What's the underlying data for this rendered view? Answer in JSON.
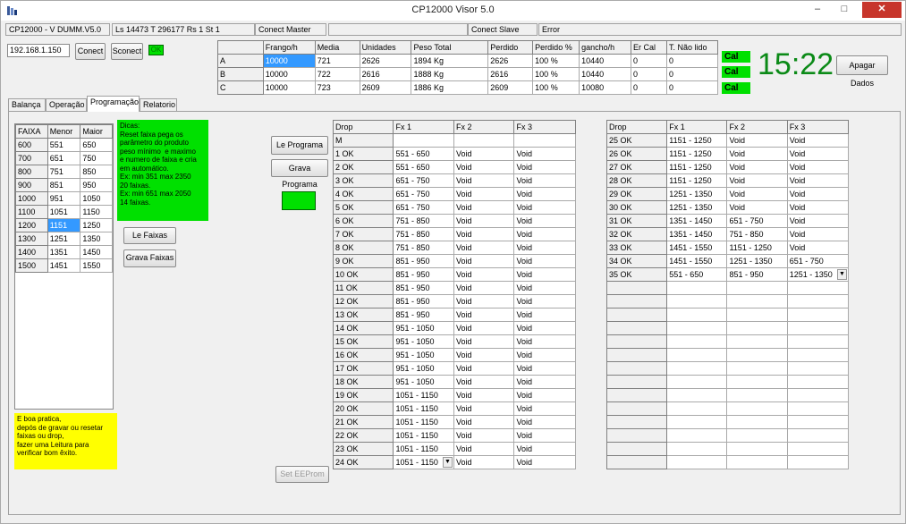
{
  "window": {
    "title": "CP12000 Visor 5.0",
    "minimize": "–",
    "maximize": "□",
    "close": "✕"
  },
  "status": {
    "version": "CP12000 - V DUMM.V5.0",
    "info": "Ls 14473 T 296177 Rs 1 St 1",
    "master": "Conect Master",
    "slave": "Conect Slave",
    "error": "Error"
  },
  "conn": {
    "ip": "192.168.1.150",
    "connect": "Conect",
    "disconnect": "Sconect",
    "ok": "OK"
  },
  "top_table": {
    "headers": [
      "",
      "Frango/h",
      "Media",
      "Unidades",
      "Peso Total",
      "Perdido",
      "Perdido %",
      "gancho/h",
      "Er Cal",
      "T. Não lido"
    ],
    "rows": [
      [
        "A",
        "10000",
        "721",
        "2626",
        "1894 Kg",
        "2626",
        "100 %",
        "10440",
        "0",
        "0"
      ],
      [
        "B",
        "10000",
        "722",
        "2616",
        "1888 Kg",
        "2616",
        "100 %",
        "10440",
        "0",
        "0"
      ],
      [
        "C",
        "10000",
        "723",
        "2609",
        "1886 Kg",
        "2609",
        "100 %",
        "10080",
        "0",
        "0"
      ]
    ]
  },
  "cal": [
    "Cal",
    "Cal",
    "Cal"
  ],
  "clock": "15:22",
  "apagar": "Apagar Dados",
  "tabs": [
    "Balança",
    "Operação",
    "Programação",
    "Relatorio"
  ],
  "faixa": {
    "headers": [
      "FAIXA",
      "Menor",
      "Maior"
    ],
    "rows": [
      [
        "600",
        "551",
        "650"
      ],
      [
        "700",
        "651",
        "750"
      ],
      [
        "800",
        "751",
        "850"
      ],
      [
        "900",
        "851",
        "950"
      ],
      [
        "1000",
        "951",
        "1050"
      ],
      [
        "1100",
        "1051",
        "1150"
      ],
      [
        "1200",
        "1151",
        "1250"
      ],
      [
        "1300",
        "1251",
        "1350"
      ],
      [
        "1400",
        "1351",
        "1450"
      ],
      [
        "1500",
        "1451",
        "1550"
      ]
    ]
  },
  "dicas": "Dicas:\nReset faixa pega os\nparâmetro do produto\npeso mínimo  e maximo\ne numero de faixa e cria\nem automático.\nEx: min 351 max 2350\n20 faixas.\nEx: min 651 max 2050\n14 faixas.",
  "le_faixas": "Le Faixas",
  "grava_faixas": "Grava Faixas",
  "boa_pratica": "E boa pratica,\ndepós de gravar ou resetar\nfaixas ou drop,\nfazer uma Leitura para\nverificar bom êxito.",
  "le_programa": "Le Programa",
  "grava_programa": "Grava Programa",
  "set_eeprom": "Set EEProm",
  "drop1": {
    "headers": [
      "Drop",
      "Fx 1",
      "Fx 2",
      "Fx 3"
    ],
    "rows": [
      [
        "M",
        "",
        "",
        ""
      ],
      [
        "1 OK",
        "551 - 650",
        "Void",
        "Void"
      ],
      [
        "2 OK",
        "551 - 650",
        "Void",
        "Void"
      ],
      [
        "3 OK",
        "651 - 750",
        "Void",
        "Void"
      ],
      [
        "4 OK",
        "651 - 750",
        "Void",
        "Void"
      ],
      [
        "5 OK",
        "651 - 750",
        "Void",
        "Void"
      ],
      [
        "6 OK",
        "751 - 850",
        "Void",
        "Void"
      ],
      [
        "7 OK",
        "751 - 850",
        "Void",
        "Void"
      ],
      [
        "8 OK",
        "751 - 850",
        "Void",
        "Void"
      ],
      [
        "9 OK",
        "851 - 950",
        "Void",
        "Void"
      ],
      [
        "10 OK",
        "851 - 950",
        "Void",
        "Void"
      ],
      [
        "11 OK",
        "851 - 950",
        "Void",
        "Void"
      ],
      [
        "12 OK",
        "851 - 950",
        "Void",
        "Void"
      ],
      [
        "13 OK",
        "851 - 950",
        "Void",
        "Void"
      ],
      [
        "14 OK",
        "951 - 1050",
        "Void",
        "Void"
      ],
      [
        "15 OK",
        "951 - 1050",
        "Void",
        "Void"
      ],
      [
        "16 OK",
        "951 - 1050",
        "Void",
        "Void"
      ],
      [
        "17 OK",
        "951 - 1050",
        "Void",
        "Void"
      ],
      [
        "18 OK",
        "951 - 1050",
        "Void",
        "Void"
      ],
      [
        "19 OK",
        "1051 - 1150",
        "Void",
        "Void"
      ],
      [
        "20 OK",
        "1051 - 1150",
        "Void",
        "Void"
      ],
      [
        "21 OK",
        "1051 - 1150",
        "Void",
        "Void"
      ],
      [
        "22 OK",
        "1051 - 1150",
        "Void",
        "Void"
      ],
      [
        "23 OK",
        "1051 - 1150",
        "Void",
        "Void"
      ],
      [
        "24 OK",
        "1051 - 1150",
        "Void",
        "Void"
      ]
    ]
  },
  "drop2": {
    "headers": [
      "Drop",
      "Fx 1",
      "Fx 2",
      "Fx 3"
    ],
    "rows": [
      [
        "25 OK",
        "1151 - 1250",
        "Void",
        "Void"
      ],
      [
        "26 OK",
        "1151 - 1250",
        "Void",
        "Void"
      ],
      [
        "27 OK",
        "1151 - 1250",
        "Void",
        "Void"
      ],
      [
        "28 OK",
        "1151 - 1250",
        "Void",
        "Void"
      ],
      [
        "29 OK",
        "1251 - 1350",
        "Void",
        "Void"
      ],
      [
        "30 OK",
        "1251 - 1350",
        "Void",
        "Void"
      ],
      [
        "31 OK",
        "1351 - 1450",
        "651 - 750",
        "Void"
      ],
      [
        "32 OK",
        "1351 - 1450",
        "751 - 850",
        "Void"
      ],
      [
        "33 OK",
        "1451 - 1550",
        "1151 - 1250",
        "Void"
      ],
      [
        "34 OK",
        "1451 - 1550",
        "1251 - 1350",
        "651 - 750"
      ],
      [
        "35 OK",
        "551 - 650",
        "851 - 950",
        "1251 - 1350"
      ]
    ],
    "empty_rows": 14
  }
}
